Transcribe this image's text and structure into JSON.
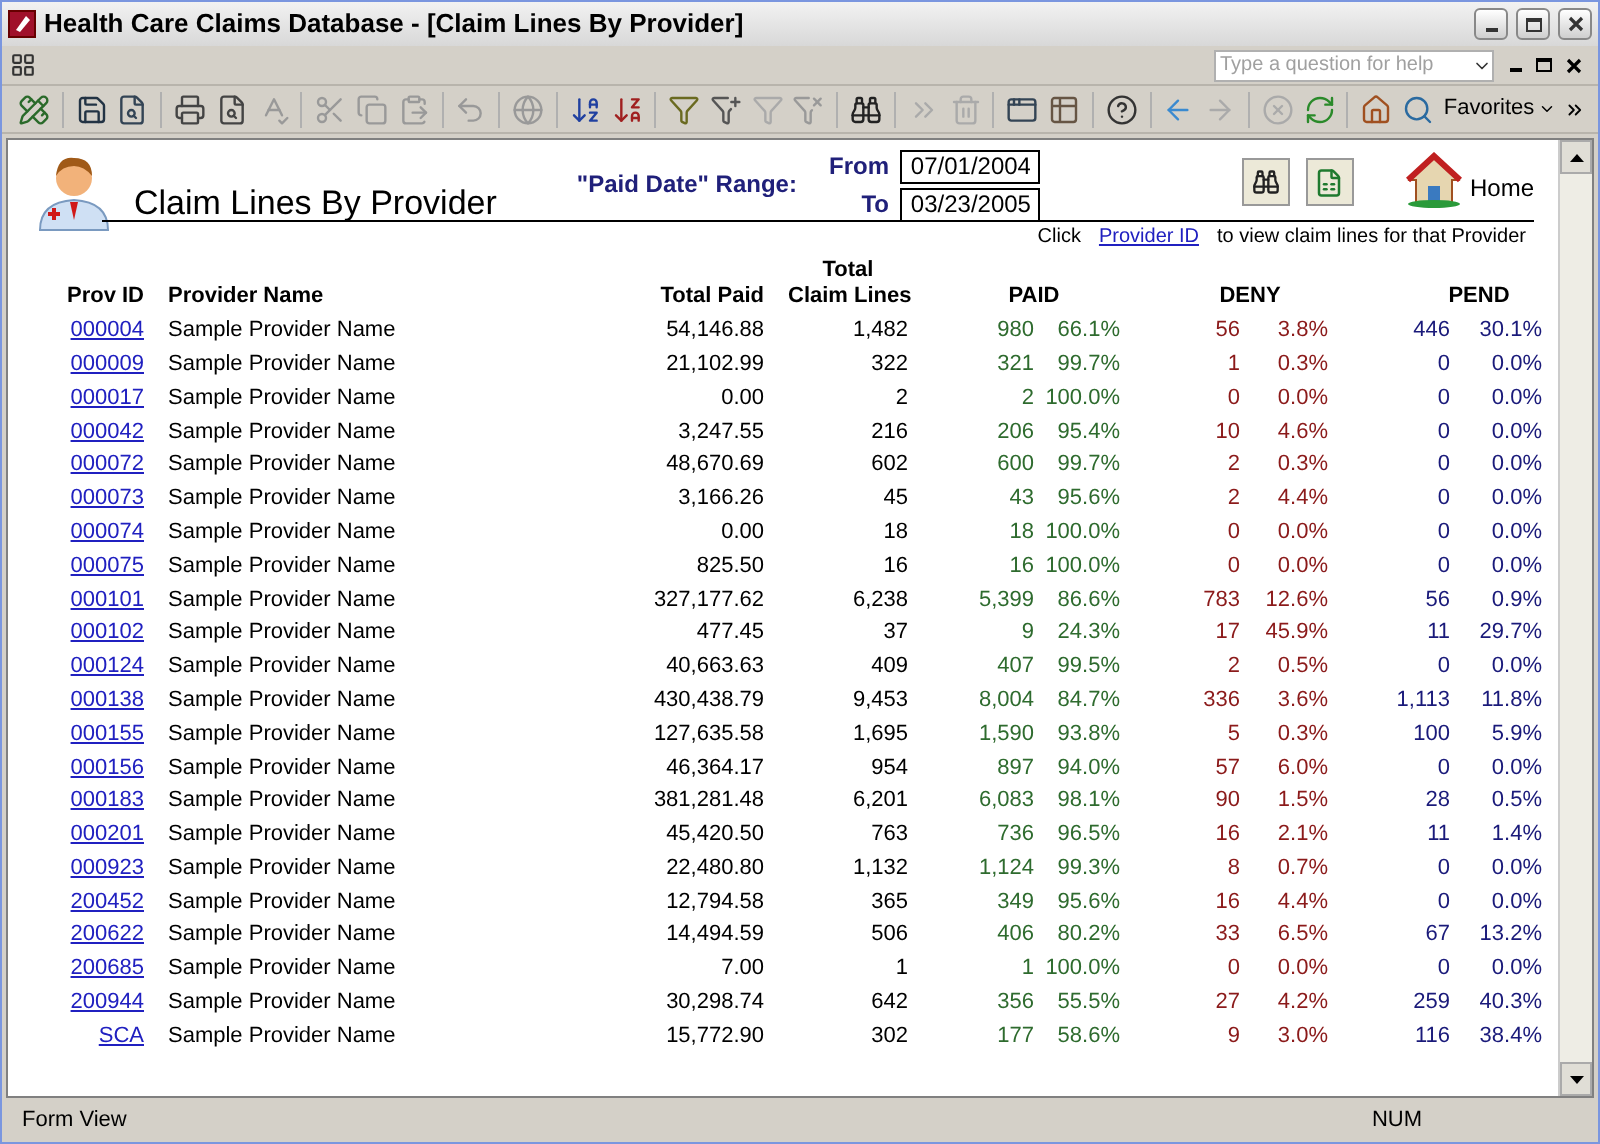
{
  "window": {
    "title": "Health Care Claims Database - [Claim Lines By Provider]"
  },
  "help_box": {
    "placeholder": "Type a question for help"
  },
  "toolbar": {
    "favorites_label": "Favorites"
  },
  "form": {
    "title": "Claim Lines By Provider",
    "range_label": "\"Paid Date\" Range:",
    "from_label": "From",
    "from_value": "07/01/2004",
    "to_label": "To",
    "to_value": "03/23/2005",
    "home_label": "Home",
    "hint_before": "Click",
    "hint_link": "Provider ID",
    "hint_after": "to view claim lines for that Provider"
  },
  "table": {
    "columns": [
      {
        "lines": [
          "Prov ID"
        ]
      },
      {
        "lines": [
          "Provider Name"
        ]
      },
      {
        "lines": [
          "Total Paid"
        ]
      },
      {
        "lines": [
          "Total",
          "Claim Lines"
        ]
      },
      {
        "lines": [
          "PAID"
        ]
      },
      {
        "lines": [
          "DENY"
        ]
      },
      {
        "lines": [
          "PEND"
        ]
      }
    ],
    "rows": [
      {
        "id": "000004",
        "name": "Sample Provider Name",
        "total_paid": "54,146.88",
        "lines": "1,482",
        "paid": "980",
        "paid_pct": "66.1%",
        "deny": "56",
        "deny_pct": "3.8%",
        "pend": "446",
        "pend_pct": "30.1%"
      },
      {
        "id": "000009",
        "name": "Sample Provider Name",
        "total_paid": "21,102.99",
        "lines": "322",
        "paid": "321",
        "paid_pct": "99.7%",
        "deny": "1",
        "deny_pct": "0.3%",
        "pend": "0",
        "pend_pct": "0.0%"
      },
      {
        "id": "000017",
        "name": "Sample Provider Name",
        "total_paid": "0.00",
        "lines": "2",
        "paid": "2",
        "paid_pct": "100.0%",
        "deny": "0",
        "deny_pct": "0.0%",
        "pend": "0",
        "pend_pct": "0.0%"
      },
      {
        "id": "000042",
        "name": "Sample Provider Name",
        "total_paid": "3,247.55",
        "lines": "216",
        "paid": "206",
        "paid_pct": "95.4%",
        "deny": "10",
        "deny_pct": "4.6%",
        "pend": "0",
        "pend_pct": "0.0%"
      },
      {
        "id": "000072",
        "name": "Sample Provider Name",
        "total_paid": "48,670.69",
        "lines": "602",
        "paid": "600",
        "paid_pct": "99.7%",
        "deny": "2",
        "deny_pct": "0.3%",
        "pend": "0",
        "pend_pct": "0.0%"
      },
      {
        "id": "000073",
        "name": "Sample Provider Name",
        "total_paid": "3,166.26",
        "lines": "45",
        "paid": "43",
        "paid_pct": "95.6%",
        "deny": "2",
        "deny_pct": "4.4%",
        "pend": "0",
        "pend_pct": "0.0%"
      },
      {
        "id": "000074",
        "name": "Sample Provider Name",
        "total_paid": "0.00",
        "lines": "18",
        "paid": "18",
        "paid_pct": "100.0%",
        "deny": "0",
        "deny_pct": "0.0%",
        "pend": "0",
        "pend_pct": "0.0%"
      },
      {
        "id": "000075",
        "name": "Sample Provider Name",
        "total_paid": "825.50",
        "lines": "16",
        "paid": "16",
        "paid_pct": "100.0%",
        "deny": "0",
        "deny_pct": "0.0%",
        "pend": "0",
        "pend_pct": "0.0%"
      },
      {
        "id": "000101",
        "name": "Sample Provider Name",
        "total_paid": "327,177.62",
        "lines": "6,238",
        "paid": "5,399",
        "paid_pct": "86.6%",
        "deny": "783",
        "deny_pct": "12.6%",
        "pend": "56",
        "pend_pct": "0.9%"
      },
      {
        "id": "000102",
        "name": "Sample Provider Name",
        "total_paid": "477.45",
        "lines": "37",
        "paid": "9",
        "paid_pct": "24.3%",
        "deny": "17",
        "deny_pct": "45.9%",
        "pend": "11",
        "pend_pct": "29.7%"
      },
      {
        "id": "000124",
        "name": "Sample Provider Name",
        "total_paid": "40,663.63",
        "lines": "409",
        "paid": "407",
        "paid_pct": "99.5%",
        "deny": "2",
        "deny_pct": "0.5%",
        "pend": "0",
        "pend_pct": "0.0%"
      },
      {
        "id": "000138",
        "name": "Sample Provider Name",
        "total_paid": "430,438.79",
        "lines": "9,453",
        "paid": "8,004",
        "paid_pct": "84.7%",
        "deny": "336",
        "deny_pct": "3.6%",
        "pend": "1,113",
        "pend_pct": "11.8%"
      },
      {
        "id": "000155",
        "name": "Sample Provider Name",
        "total_paid": "127,635.58",
        "lines": "1,695",
        "paid": "1,590",
        "paid_pct": "93.8%",
        "deny": "5",
        "deny_pct": "0.3%",
        "pend": "100",
        "pend_pct": "5.9%"
      },
      {
        "id": "000156",
        "name": "Sample Provider Name",
        "total_paid": "46,364.17",
        "lines": "954",
        "paid": "897",
        "paid_pct": "94.0%",
        "deny": "57",
        "deny_pct": "6.0%",
        "pend": "0",
        "pend_pct": "0.0%"
      },
      {
        "id": "000183",
        "name": "Sample Provider Name",
        "total_paid": "381,281.48",
        "lines": "6,201",
        "paid": "6,083",
        "paid_pct": "98.1%",
        "deny": "90",
        "deny_pct": "1.5%",
        "pend": "28",
        "pend_pct": "0.5%"
      },
      {
        "id": "000201",
        "name": "Sample Provider Name",
        "total_paid": "45,420.50",
        "lines": "763",
        "paid": "736",
        "paid_pct": "96.5%",
        "deny": "16",
        "deny_pct": "2.1%",
        "pend": "11",
        "pend_pct": "1.4%"
      },
      {
        "id": "000923",
        "name": "Sample Provider Name",
        "total_paid": "22,480.80",
        "lines": "1,132",
        "paid": "1,124",
        "paid_pct": "99.3%",
        "deny": "8",
        "deny_pct": "0.7%",
        "pend": "0",
        "pend_pct": "0.0%"
      },
      {
        "id": "200452",
        "name": "Sample Provider Name",
        "total_paid": "12,794.58",
        "lines": "365",
        "paid": "349",
        "paid_pct": "95.6%",
        "deny": "16",
        "deny_pct": "4.4%",
        "pend": "0",
        "pend_pct": "0.0%"
      },
      {
        "id": "200622",
        "name": "Sample Provider Name",
        "total_paid": "14,494.59",
        "lines": "506",
        "paid": "406",
        "paid_pct": "80.2%",
        "deny": "33",
        "deny_pct": "6.5%",
        "pend": "67",
        "pend_pct": "13.2%"
      },
      {
        "id": "200685",
        "name": "Sample Provider Name",
        "total_paid": "7.00",
        "lines": "1",
        "paid": "1",
        "paid_pct": "100.0%",
        "deny": "0",
        "deny_pct": "0.0%",
        "pend": "0",
        "pend_pct": "0.0%"
      },
      {
        "id": "200944",
        "name": "Sample Provider Name",
        "total_paid": "30,298.74",
        "lines": "642",
        "paid": "356",
        "paid_pct": "55.5%",
        "deny": "27",
        "deny_pct": "4.2%",
        "pend": "259",
        "pend_pct": "40.3%"
      },
      {
        "id": "SCA",
        "name": "Sample Provider Name",
        "total_paid": "15,772.90",
        "lines": "302",
        "paid": "177",
        "paid_pct": "58.6%",
        "deny": "9",
        "deny_pct": "3.0%",
        "pend": "116",
        "pend_pct": "38.4%"
      }
    ]
  },
  "status_bar": {
    "left": "Form View",
    "right": "NUM"
  }
}
